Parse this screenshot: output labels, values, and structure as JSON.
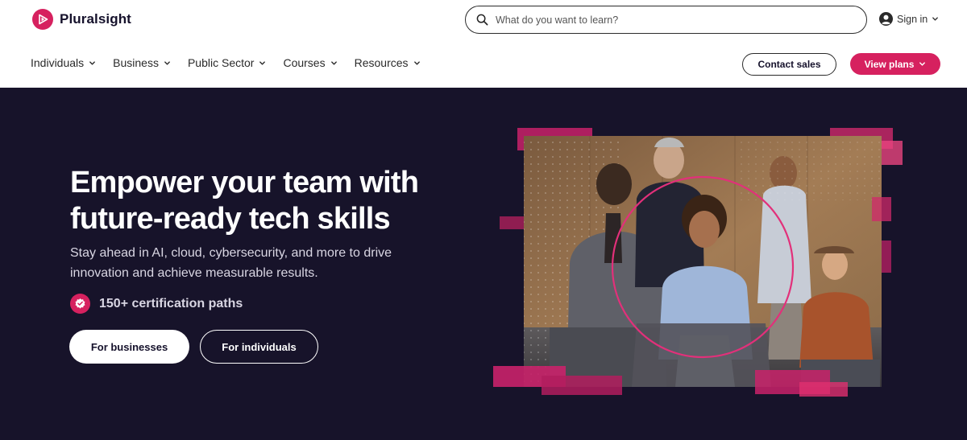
{
  "brand": {
    "name": "Pluralsight",
    "accent": "#d6215f",
    "dark": "#17132a",
    "logo_icon": "play-triangle-icon"
  },
  "search": {
    "placeholder": "What do you want to learn?",
    "value": "",
    "icon": "search-icon"
  },
  "signin": {
    "label": "Sign in",
    "icon": "user-circle-icon"
  },
  "nav": {
    "items": [
      {
        "label": "Individuals"
      },
      {
        "label": "Business"
      },
      {
        "label": "Public Sector"
      },
      {
        "label": "Courses"
      },
      {
        "label": "Resources"
      }
    ]
  },
  "actions": {
    "contact_label": "Contact sales",
    "plans_label": "View plans"
  },
  "hero": {
    "title": "Empower your team with future-ready tech skills",
    "subtitle": "Stay ahead in AI, cloud, cybersecurity, and more to drive innovation and achieve measurable results.",
    "cert_label": "150+ certification paths",
    "cert_icon": "check-badge-icon",
    "primary_cta": "For businesses",
    "secondary_cta": "For individuals",
    "image_icon": "team-photo"
  }
}
